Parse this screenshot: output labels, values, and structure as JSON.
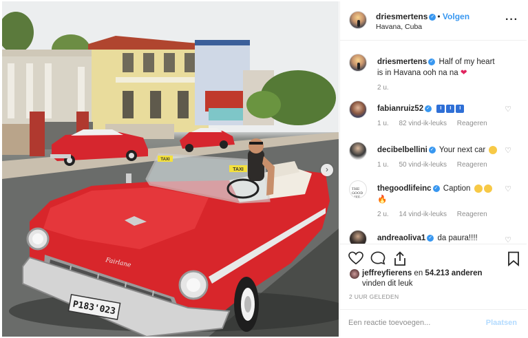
{
  "post": {
    "author": "driesmertens",
    "follow_label": "Volgen",
    "location": "Havana, Cuba",
    "more_icon": "more-horizontal-icon",
    "license_plate": "P183'023",
    "car_badge": "Fairlane",
    "taxi_sign": "TAXI"
  },
  "caption": {
    "username": "driesmertens",
    "text": "Half of my heart is in Havana ooh na na",
    "time": "2 u."
  },
  "comments": [
    {
      "username": "fabianruiz52",
      "text": "",
      "boxes": [
        "I",
        "I",
        "I"
      ],
      "time": "1 u.",
      "likes": "82 vind-ik-leuks",
      "reply": "Reageren"
    },
    {
      "username": "decibelbellini",
      "text": "Your next car",
      "time": "1 u.",
      "likes": "50 vind-ik-leuks",
      "reply": "Reageren"
    },
    {
      "username": "thegoodlifeinc",
      "text": "Caption",
      "time": "2 u.",
      "likes": "14 vind-ik-leuks",
      "reply": "Reageren"
    },
    {
      "username": "andreaoliva1",
      "text": "da paura!!!!",
      "time": "",
      "likes": "",
      "reply": ""
    }
  ],
  "thegoodlife_logo": "THE GOOD LIFE",
  "likes": {
    "prefix_user": "jeffreyfierens",
    "middle": " en ",
    "count": "54.213 anderen",
    "suffix": "vinden dit leuk"
  },
  "timestamp": "2 UUR GELEDEN",
  "add_comment": {
    "placeholder": "Een reactie toevoegen...",
    "post_label": "Plaatsen"
  },
  "colors": {
    "accent": "#3897f0",
    "car_red": "#d8262b",
    "verified": "#3897f0"
  }
}
